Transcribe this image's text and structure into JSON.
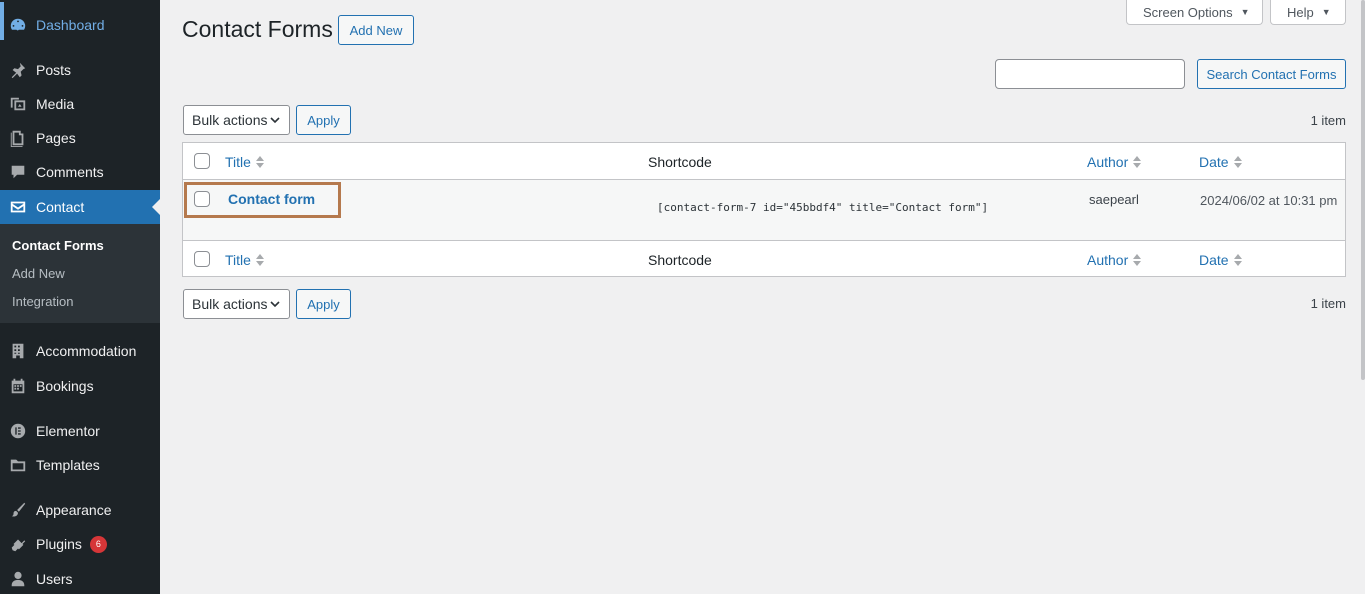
{
  "sidebar": {
    "items": [
      {
        "label": "Dashboard",
        "icon": "dashboard-icon"
      },
      {
        "label": "Posts",
        "icon": "pin-icon"
      },
      {
        "label": "Media",
        "icon": "media-icon"
      },
      {
        "label": "Pages",
        "icon": "pages-icon"
      },
      {
        "label": "Comments",
        "icon": "comment-icon"
      },
      {
        "label": "Contact",
        "icon": "envelope-icon"
      },
      {
        "label": "Accommodation",
        "icon": "building-icon"
      },
      {
        "label": "Bookings",
        "icon": "calendar-icon"
      },
      {
        "label": "Elementor",
        "icon": "elementor-icon"
      },
      {
        "label": "Templates",
        "icon": "folder-icon"
      },
      {
        "label": "Appearance",
        "icon": "brush-icon"
      },
      {
        "label": "Plugins",
        "icon": "plug-icon",
        "badge": "6"
      },
      {
        "label": "Users",
        "icon": "user-icon"
      }
    ],
    "submenu": [
      "Contact Forms",
      "Add New",
      "Integration"
    ]
  },
  "topbar": {
    "screen_options": "Screen Options",
    "help": "Help"
  },
  "header": {
    "title": "Contact Forms",
    "add_new": "Add New"
  },
  "search": {
    "button": "Search Contact Forms",
    "value": ""
  },
  "bulk": {
    "select": "Bulk actions",
    "apply": "Apply",
    "count": "1 item"
  },
  "table": {
    "columns": [
      "Title",
      "Shortcode",
      "Author",
      "Date"
    ],
    "rows": [
      {
        "title": "Contact form",
        "shortcode": "[contact-form-7 id=\"45bbdf4\" title=\"Contact form\"]",
        "author": "saepearl",
        "date": "2024/06/02 at 10:31 pm"
      }
    ]
  },
  "colors": {
    "sidebar_bg": "#1d2327",
    "accent": "#2271b1",
    "highlight_border": "#b5794d",
    "badge": "#d63638"
  }
}
